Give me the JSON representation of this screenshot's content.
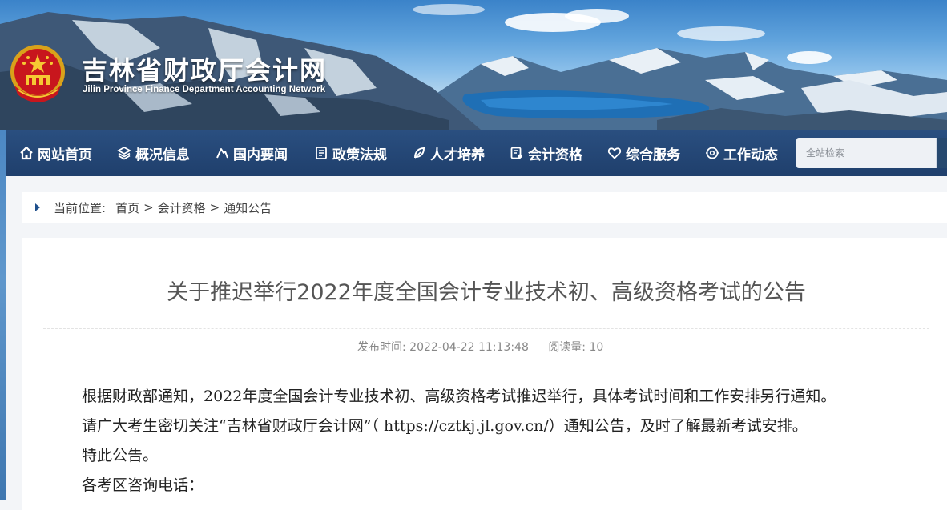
{
  "header": {
    "site_title": "吉林省财政厅会计网",
    "site_subtitle": "Jilin Province Finance Department Accounting Network"
  },
  "nav": {
    "items": [
      {
        "label": "网站首页",
        "icon": "home-icon"
      },
      {
        "label": "概况信息",
        "icon": "layers-icon"
      },
      {
        "label": "国内要闻",
        "icon": "news-icon"
      },
      {
        "label": "政策法规",
        "icon": "document-icon"
      },
      {
        "label": "人才培养",
        "icon": "leaf-icon"
      },
      {
        "label": "会计资格",
        "icon": "certificate-icon"
      },
      {
        "label": "综合服务",
        "icon": "heart-icon"
      },
      {
        "label": "工作动态",
        "icon": "gear-icon"
      }
    ],
    "search_placeholder": "全站检索"
  },
  "breadcrumb": {
    "label": "当前位置:",
    "items": [
      "首页",
      "会计资格",
      "通知公告"
    ],
    "separator": ">"
  },
  "article": {
    "title": "关于推迟举行2022年度全国会计专业技术初、高级资格考试的公告",
    "publish_time": "发布时间:  2022-04-22 11:13:48",
    "views": "阅读量:  10",
    "paragraphs": [
      "根据财政部通知，2022年度全国会计专业技术初、高级资格考试推迟举行，具体考试时间和工作安排另行通知。",
      "请广大考生密切关注“吉林省财政厅会计网”（ https://cztkj.jl.gov.cn/）通知公告，及时了解最新考试安排。",
      "特此公告。",
      "各考区咨询电话："
    ]
  },
  "colors": {
    "nav_bg": "#24466f",
    "accent": "#1e4f8c"
  }
}
